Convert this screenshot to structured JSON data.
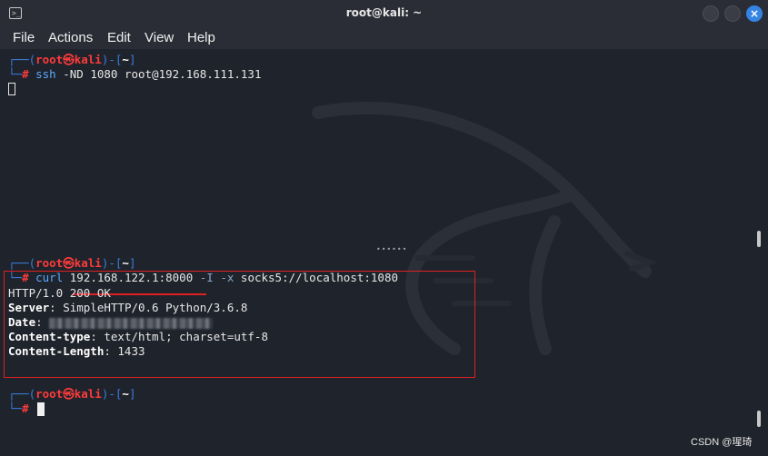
{
  "window": {
    "title": "root@kali: ~",
    "close_glyph": "×"
  },
  "menu": [
    "File",
    "Actions",
    "Edit",
    "View",
    "Help"
  ],
  "prompt": {
    "top_left": "┌──(",
    "user": "root",
    "at": "㉿",
    "host": "kali",
    "mid": ")-[",
    "dir": "~",
    "end": "]",
    "bottom": "└─",
    "hash": "#"
  },
  "commands": {
    "ssh": {
      "cmd": "ssh",
      "args": " -ND 1080 root@192.168.111.131"
    },
    "curl": {
      "cmd": "curl",
      "target": "192.168.122.1:8000",
      "flags": " -I -x ",
      "proxy": "socks5://localhost:1080"
    }
  },
  "response": {
    "status": "HTTP/1.0 200 OK",
    "server_label": "Server",
    "server_value": ": SimpleHTTP/0.6 Python/3.6.8",
    "date_label": "Date",
    "date_value": ": ",
    "ctype_label": "Content-type",
    "ctype_value": ": text/html; charset=utf-8",
    "clen_label": "Content-Length",
    "clen_value": ": 1433"
  },
  "watermark": "CSDN @瑆琦",
  "icons": {
    "terminal": "terminal-icon",
    "dragon": "kali-dragon-icon"
  },
  "colors": {
    "prompt_blue": "#3b7ddd",
    "prompt_red": "#ff3b3b",
    "highlight_red": "#e02020",
    "close_blue": "#3584e4"
  }
}
